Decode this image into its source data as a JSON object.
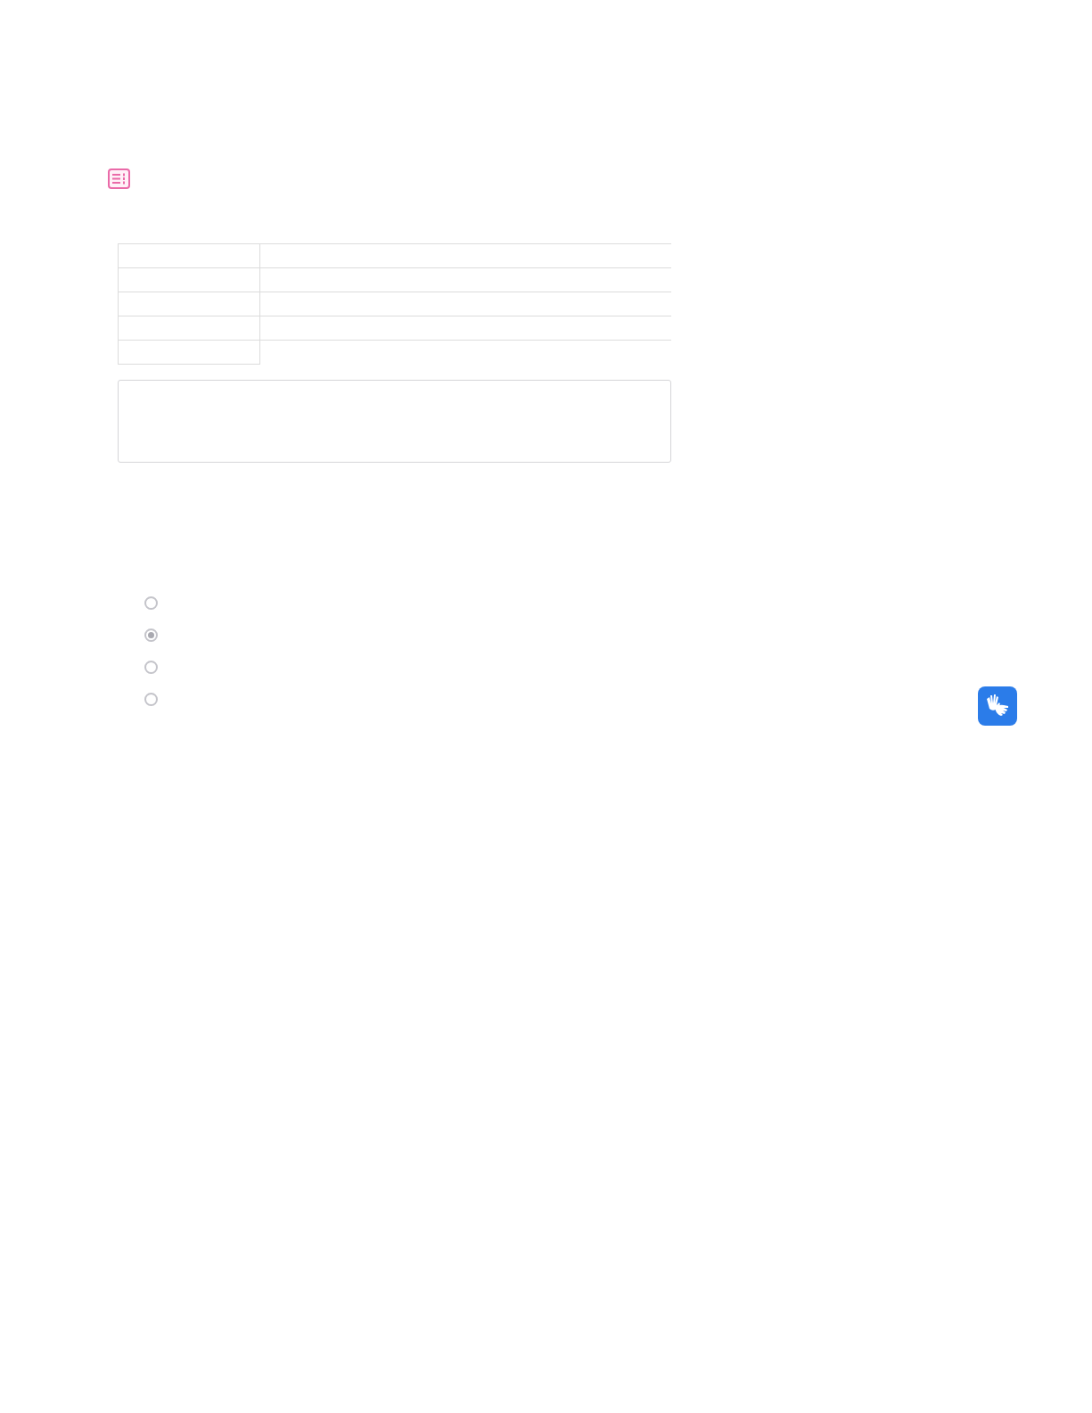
{
  "header_icon": {
    "kind": "list-settings"
  },
  "table": {
    "rows": [
      {
        "kind": "full"
      },
      {
        "kind": "full"
      },
      {
        "kind": "full"
      },
      {
        "kind": "full"
      },
      {
        "kind": "label-only"
      }
    ]
  },
  "note_box": {
    "kind": "textarea"
  },
  "radio_options": [
    {
      "selected": false
    },
    {
      "selected": true
    },
    {
      "selected": false
    },
    {
      "selected": false
    }
  ],
  "accessibility_button": {
    "kind": "sign-language"
  }
}
